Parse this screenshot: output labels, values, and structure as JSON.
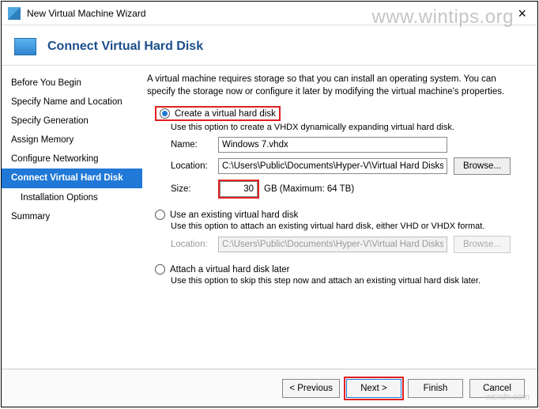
{
  "window_title": "New Virtual Machine Wizard",
  "watermark": "www.wintips.org",
  "header": {
    "title": "Connect Virtual Hard Disk"
  },
  "sidebar": {
    "items": [
      {
        "label": "Before You Begin"
      },
      {
        "label": "Specify Name and Location"
      },
      {
        "label": "Specify Generation"
      },
      {
        "label": "Assign Memory"
      },
      {
        "label": "Configure Networking"
      },
      {
        "label": "Connect Virtual Hard Disk"
      },
      {
        "label": "Installation Options"
      },
      {
        "label": "Summary"
      }
    ]
  },
  "main": {
    "description": "A virtual machine requires storage so that you can install an operating system. You can specify the storage now or configure it later by modifying the virtual machine's properties.",
    "opt_create": {
      "label": "Create a virtual hard disk",
      "note": "Use this option to create a VHDX dynamically expanding virtual hard disk.",
      "name_lbl": "Name:",
      "name_val": "Windows 7.vhdx",
      "loc_lbl": "Location:",
      "loc_val": "C:\\Users\\Public\\Documents\\Hyper-V\\Virtual Hard Disks\\",
      "browse_lbl": "Browse...",
      "size_lbl": "Size:",
      "size_val": "30",
      "size_unit": "GB (Maximum: 64 TB)"
    },
    "opt_existing": {
      "label": "Use an existing virtual hard disk",
      "note": "Use this option to attach an existing virtual hard disk, either VHD or VHDX format.",
      "loc_lbl": "Location:",
      "loc_val": "C:\\Users\\Public\\Documents\\Hyper-V\\Virtual Hard Disks\\",
      "browse_lbl": "Browse..."
    },
    "opt_later": {
      "label": "Attach a virtual hard disk later",
      "note": "Use this option to skip this step now and attach an existing virtual hard disk later."
    }
  },
  "footer": {
    "prev": "< Previous",
    "next": "Next >",
    "finish": "Finish",
    "cancel": "Cancel"
  },
  "bottom_mark": "wsxdn.com"
}
